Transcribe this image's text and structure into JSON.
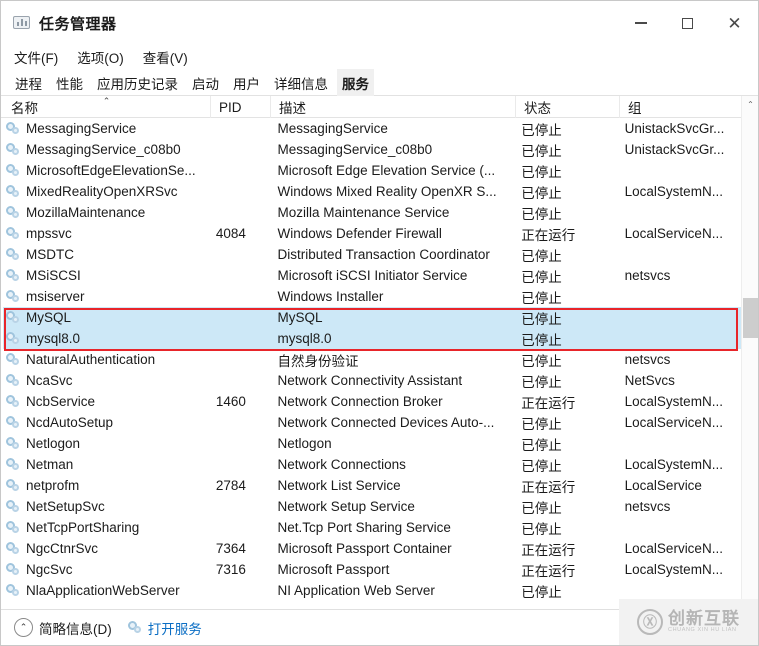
{
  "window": {
    "title": "任务管理器",
    "icon": "task-manager-icon",
    "minimize_label": "",
    "maximize_label": "",
    "close_label": "✕"
  },
  "menu": {
    "items": [
      {
        "label": "文件(F)"
      },
      {
        "label": "选项(O)"
      },
      {
        "label": "查看(V)"
      }
    ]
  },
  "tabs": {
    "items": [
      {
        "label": "进程",
        "active": false
      },
      {
        "label": "性能",
        "active": false
      },
      {
        "label": "应用历史记录",
        "active": false
      },
      {
        "label": "启动",
        "active": false
      },
      {
        "label": "用户",
        "active": false
      },
      {
        "label": "详细信息",
        "active": false
      },
      {
        "label": "服务",
        "active": true
      }
    ]
  },
  "table": {
    "sort_column": "名称",
    "sort_caret": "⌃",
    "columns": [
      {
        "key": "name",
        "label": "名称"
      },
      {
        "key": "pid",
        "label": "PID"
      },
      {
        "key": "desc",
        "label": "描述"
      },
      {
        "key": "status",
        "label": "状态"
      },
      {
        "key": "group",
        "label": "组"
      }
    ],
    "rows": [
      {
        "name": "MessagingService",
        "pid": "",
        "desc": "MessagingService",
        "status": "已停止",
        "group": "UnistackSvcGr...",
        "selected": false
      },
      {
        "name": "MessagingService_c08b0",
        "pid": "",
        "desc": "MessagingService_c08b0",
        "status": "已停止",
        "group": "UnistackSvcGr...",
        "selected": false
      },
      {
        "name": "MicrosoftEdgeElevationSe...",
        "pid": "",
        "desc": "Microsoft Edge Elevation Service (...",
        "status": "已停止",
        "group": "",
        "selected": false
      },
      {
        "name": "MixedRealityOpenXRSvc",
        "pid": "",
        "desc": "Windows Mixed Reality OpenXR S...",
        "status": "已停止",
        "group": "LocalSystemN...",
        "selected": false
      },
      {
        "name": "MozillaMaintenance",
        "pid": "",
        "desc": "Mozilla Maintenance Service",
        "status": "已停止",
        "group": "",
        "selected": false
      },
      {
        "name": "mpssvc",
        "pid": "4084",
        "desc": "Windows Defender Firewall",
        "status": "正在运行",
        "group": "LocalServiceN...",
        "selected": false
      },
      {
        "name": "MSDTC",
        "pid": "",
        "desc": "Distributed Transaction Coordinator",
        "status": "已停止",
        "group": "",
        "selected": false
      },
      {
        "name": "MSiSCSI",
        "pid": "",
        "desc": "Microsoft iSCSI Initiator Service",
        "status": "已停止",
        "group": "netsvcs",
        "selected": false
      },
      {
        "name": "msiserver",
        "pid": "",
        "desc": "Windows Installer",
        "status": "已停止",
        "group": "",
        "selected": false
      },
      {
        "name": "MySQL",
        "pid": "",
        "desc": "MySQL",
        "status": "已停止",
        "group": "",
        "selected": true
      },
      {
        "name": "mysql8.0",
        "pid": "",
        "desc": "mysql8.0",
        "status": "已停止",
        "group": "",
        "selected": true
      },
      {
        "name": "NaturalAuthentication",
        "pid": "",
        "desc": "自然身份验证",
        "status": "已停止",
        "group": "netsvcs",
        "selected": false
      },
      {
        "name": "NcaSvc",
        "pid": "",
        "desc": "Network Connectivity Assistant",
        "status": "已停止",
        "group": "NetSvcs",
        "selected": false
      },
      {
        "name": "NcbService",
        "pid": "1460",
        "desc": "Network Connection Broker",
        "status": "正在运行",
        "group": "LocalSystemN...",
        "selected": false
      },
      {
        "name": "NcdAutoSetup",
        "pid": "",
        "desc": "Network Connected Devices Auto-...",
        "status": "已停止",
        "group": "LocalServiceN...",
        "selected": false
      },
      {
        "name": "Netlogon",
        "pid": "",
        "desc": "Netlogon",
        "status": "已停止",
        "group": "",
        "selected": false
      },
      {
        "name": "Netman",
        "pid": "",
        "desc": "Network Connections",
        "status": "已停止",
        "group": "LocalSystemN...",
        "selected": false
      },
      {
        "name": "netprofm",
        "pid": "2784",
        "desc": "Network List Service",
        "status": "正在运行",
        "group": "LocalService",
        "selected": false
      },
      {
        "name": "NetSetupSvc",
        "pid": "",
        "desc": "Network Setup Service",
        "status": "已停止",
        "group": "netsvcs",
        "selected": false
      },
      {
        "name": "NetTcpPortSharing",
        "pid": "",
        "desc": "Net.Tcp Port Sharing Service",
        "status": "已停止",
        "group": "",
        "selected": false
      },
      {
        "name": "NgcCtnrSvc",
        "pid": "7364",
        "desc": "Microsoft Passport Container",
        "status": "正在运行",
        "group": "LocalServiceN...",
        "selected": false
      },
      {
        "name": "NgcSvc",
        "pid": "7316",
        "desc": "Microsoft Passport",
        "status": "正在运行",
        "group": "LocalSystemN...",
        "selected": false
      },
      {
        "name": "NlaApplicationWebServer",
        "pid": "",
        "desc": "NI Application Web Server",
        "status": "已停止",
        "group": "",
        "selected": false
      }
    ]
  },
  "scrollbar": {
    "up_arrow": "⌃",
    "down_arrow": "⌄"
  },
  "footer": {
    "fewer_details_label": "简略信息(D)",
    "fewer_chevron": "⌃",
    "open_services_label": "打开服务"
  },
  "annotation": {
    "highlight_color": "#e8252a"
  },
  "watermark": {
    "mark": "Ⓧ",
    "cn": "创新互联",
    "en": "CHUANG XIN HU LIAN"
  }
}
